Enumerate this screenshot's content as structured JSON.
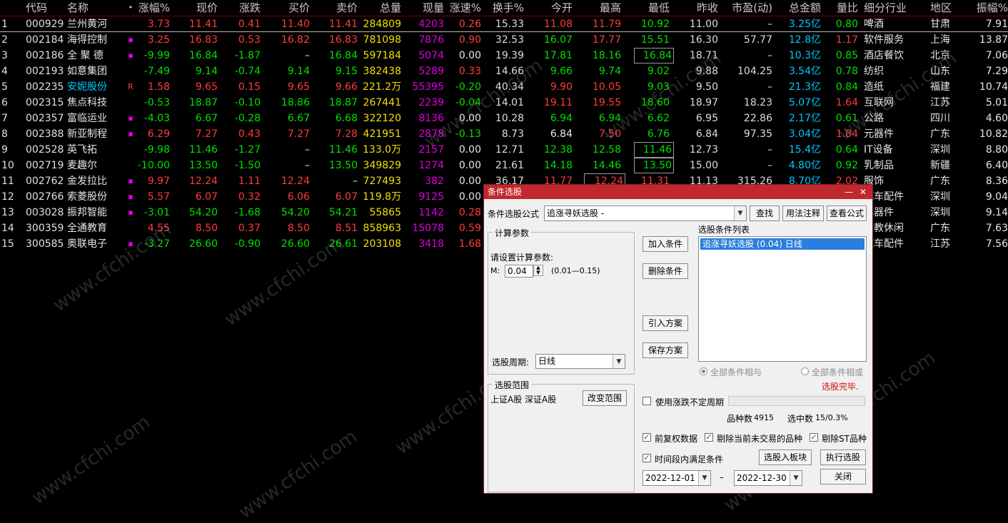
{
  "table": {
    "headers": {
      "idx": "",
      "code": "代码",
      "name": "名称",
      "flag": "•",
      "pct": "涨幅%",
      "price": "现价",
      "chg": "涨跌",
      "bid": "买价",
      "ask": "卖价",
      "vol": "总量",
      "cur": "现量",
      "spd": "涨速%",
      "turn": "换手%",
      "open": "今开",
      "high": "最高",
      "low": "最低",
      "prev": "昨收",
      "pe": "市盈(动)",
      "amt": "总金额",
      "vr": "量比",
      "ind": "细分行业",
      "reg": "地区",
      "amp": "振幅%"
    },
    "rows": [
      {
        "idx": "1",
        "code": "000929",
        "name": "兰州黄河",
        "flag": "",
        "pct": "3.73",
        "price": "11.41",
        "chg": "0.41",
        "bid": "11.40",
        "ask": "11.41",
        "vol": "284809",
        "cur": "4203",
        "spd": "0.26",
        "turn": "15.33",
        "open": "11.08",
        "high": "11.79",
        "low": "10.92",
        "prev": "11.00",
        "pe": "–",
        "amt": "3.25亿",
        "vr": "0.80",
        "ind": "啤酒",
        "reg": "甘肃",
        "amp": "7.91"
      },
      {
        "idx": "2",
        "code": "002184",
        "name": "海得控制",
        "flag": "▪",
        "pct": "3.25",
        "price": "16.83",
        "chg": "0.53",
        "bid": "16.82",
        "ask": "16.83",
        "vol": "781098",
        "cur": "7876",
        "spd": "0.90",
        "turn": "32.53",
        "open": "16.07",
        "high": "17.77",
        "low": "15.51",
        "prev": "16.30",
        "pe": "57.77",
        "amt": "12.8亿",
        "vr": "1.17",
        "ind": "软件服务",
        "reg": "上海",
        "amp": "13.87"
      },
      {
        "idx": "3",
        "code": "002186",
        "name": "全 聚 德",
        "flag": "▪",
        "pct": "-9.99",
        "price": "16.84",
        "chg": "-1.87",
        "bid": "–",
        "ask": "16.84",
        "vol": "597184",
        "cur": "5074",
        "spd": "0.00",
        "turn": "19.39",
        "open": "17.81",
        "high": "18.16",
        "low": "16.84",
        "prev": "18.71",
        "pe": "–",
        "amt": "10.3亿",
        "vr": "0.85",
        "ind": "酒店餐饮",
        "reg": "北京",
        "amp": "7.06"
      },
      {
        "idx": "4",
        "code": "002193",
        "name": "如意集团",
        "flag": "",
        "pct": "-7.49",
        "price": "9.14",
        "chg": "-0.74",
        "bid": "9.14",
        "ask": "9.15",
        "vol": "382438",
        "cur": "5289",
        "spd": "0.33",
        "turn": "14.66",
        "open": "9.66",
        "high": "9.74",
        "low": "9.02",
        "prev": "9.88",
        "pe": "104.25",
        "amt": "3.54亿",
        "vr": "0.78",
        "ind": "纺织",
        "reg": "山东",
        "amp": "7.29"
      },
      {
        "idx": "5",
        "code": "002235",
        "name": "安妮股份",
        "flag": "R",
        "pct": "1.58",
        "price": "9.65",
        "chg": "0.15",
        "bid": "9.65",
        "ask": "9.66",
        "vol": "221.2万",
        "cur": "55395",
        "spd": "-0.20",
        "turn": "40.34",
        "open": "9.90",
        "high": "10.05",
        "low": "9.03",
        "prev": "9.50",
        "pe": "–",
        "amt": "21.3亿",
        "vr": "0.84",
        "ind": "造纸",
        "reg": "福建",
        "amp": "10.74"
      },
      {
        "idx": "6",
        "code": "002315",
        "name": "焦点科技",
        "flag": "",
        "pct": "-0.53",
        "price": "18.87",
        "chg": "-0.10",
        "bid": "18.86",
        "ask": "18.87",
        "vol": "267441",
        "cur": "2239",
        "spd": "-0.04",
        "turn": "14.01",
        "open": "19.11",
        "high": "19.55",
        "low": "18.60",
        "prev": "18.97",
        "pe": "18.23",
        "amt": "5.07亿",
        "vr": "1.64",
        "ind": "互联网",
        "reg": "江苏",
        "amp": "5.01"
      },
      {
        "idx": "7",
        "code": "002357",
        "name": "富临运业",
        "flag": "▪",
        "pct": "-4.03",
        "price": "6.67",
        "chg": "-0.28",
        "bid": "6.67",
        "ask": "6.68",
        "vol": "322120",
        "cur": "8136",
        "spd": "0.00",
        "turn": "10.28",
        "open": "6.94",
        "high": "6.94",
        "low": "6.62",
        "prev": "6.95",
        "pe": "22.86",
        "amt": "2.17亿",
        "vr": "0.61",
        "ind": "公路",
        "reg": "四川",
        "amp": "4.60"
      },
      {
        "idx": "8",
        "code": "002388",
        "name": "新亚制程",
        "flag": "▪",
        "pct": "6.29",
        "price": "7.27",
        "chg": "0.43",
        "bid": "7.27",
        "ask": "7.28",
        "vol": "421951",
        "cur": "2878",
        "spd": "-0.13",
        "turn": "8.73",
        "open": "6.84",
        "high": "7.50",
        "low": "6.76",
        "prev": "6.84",
        "pe": "97.35",
        "amt": "3.04亿",
        "vr": "1.84",
        "ind": "元器件",
        "reg": "广东",
        "amp": "10.82"
      },
      {
        "idx": "9",
        "code": "002528",
        "name": "英飞拓",
        "flag": "",
        "pct": "-9.98",
        "price": "11.46",
        "chg": "-1.27",
        "bid": "–",
        "ask": "11.46",
        "vol": "133.0万",
        "cur": "2157",
        "spd": "0.00",
        "turn": "12.71",
        "open": "12.38",
        "high": "12.58",
        "low": "11.46",
        "prev": "12.73",
        "pe": "–",
        "amt": "15.4亿",
        "vr": "0.64",
        "ind": "IT设备",
        "reg": "深圳",
        "amp": "8.80"
      },
      {
        "idx": "10",
        "code": "002719",
        "name": "麦趣尔",
        "flag": "",
        "pct": "-10.00",
        "price": "13.50",
        "chg": "-1.50",
        "bid": "–",
        "ask": "13.50",
        "vol": "349829",
        "cur": "1274",
        "spd": "0.00",
        "turn": "21.61",
        "open": "14.18",
        "high": "14.46",
        "low": "13.50",
        "prev": "15.00",
        "pe": "–",
        "amt": "4.80亿",
        "vr": "0.92",
        "ind": "乳制品",
        "reg": "新疆",
        "amp": "6.40"
      },
      {
        "idx": "11",
        "code": "002762",
        "name": "金发拉比",
        "flag": "▪",
        "pct": "9.97",
        "price": "12.24",
        "chg": "1.11",
        "bid": "12.24",
        "ask": "–",
        "vol": "727493",
        "cur": "382",
        "spd": "0.00",
        "turn": "36.17",
        "open": "11.77",
        "high": "12.24",
        "low": "11.31",
        "prev": "11.13",
        "pe": "315.26",
        "amt": "8.70亿",
        "vr": "2.02",
        "ind": "服饰",
        "reg": "广东",
        "amp": "8.36"
      },
      {
        "idx": "12",
        "code": "002766",
        "name": "索菱股份",
        "flag": "▪",
        "pct": "5.57",
        "price": "6.07",
        "chg": "0.32",
        "bid": "6.06",
        "ask": "6.07",
        "vol": "119.8万",
        "cur": "9125",
        "spd": "0.00",
        "turn": "",
        "open": "",
        "high": "",
        "low": "",
        "prev": "",
        "pe": "",
        "amt": "",
        "vr": "",
        "ind": "汽车配件",
        "reg": "深圳",
        "amp": "9.04"
      },
      {
        "idx": "13",
        "code": "003028",
        "name": "振邦智能",
        "flag": "▪",
        "pct": "-3.01",
        "price": "54.20",
        "chg": "-1.68",
        "bid": "54.20",
        "ask": "54.21",
        "vol": "55865",
        "cur": "1142",
        "spd": "0.28",
        "turn": "",
        "open": "",
        "high": "",
        "low": "",
        "prev": "",
        "pe": "",
        "amt": "",
        "vr": "",
        "ind": "元器件",
        "reg": "深圳",
        "amp": "9.14"
      },
      {
        "idx": "14",
        "code": "300359",
        "name": "全通教育",
        "flag": "",
        "pct": "4.55",
        "price": "8.50",
        "chg": "0.37",
        "bid": "8.50",
        "ask": "8.51",
        "vol": "858963",
        "cur": "15078",
        "spd": "0.59",
        "turn": "",
        "open": "",
        "high": "",
        "low": "",
        "prev": "",
        "pe": "",
        "amt": "",
        "vr": "",
        "ind": "文教休闲",
        "reg": "广东",
        "amp": "7.63"
      },
      {
        "idx": "15",
        "code": "300585",
        "name": "奥联电子",
        "flag": "▪",
        "pct": "-3.27",
        "price": "26.60",
        "chg": "-0.90",
        "bid": "26.60",
        "ask": "26.61",
        "vol": "203108",
        "cur": "3418",
        "spd": "1.68",
        "turn": "",
        "open": "",
        "high": "",
        "low": "",
        "prev": "",
        "pe": "",
        "amt": "",
        "vr": "",
        "ind": "汽车配件",
        "reg": "江苏",
        "amp": "7.56"
      }
    ]
  },
  "watermark": "www.cfchi.com",
  "dialog": {
    "title": "条件选股",
    "min_icon": "—",
    "close_icon": "✕",
    "formula_label": "条件选股公式",
    "formula_value": "追涨寻妖选股 -",
    "dropdown_icon": "▼",
    "find_btn": "查找",
    "usage_btn": "用法注释",
    "view_formula_btn": "查看公式",
    "calc_group": "计算参数",
    "calc_prompt": "请设置计算参数:",
    "param_label": "M:",
    "param_value": "0.04",
    "param_range": "(0.01—0.15)",
    "add_cond_btn": "加入条件",
    "del_cond_btn": "删除条件",
    "import_btn": "引入方案",
    "save_btn": "保存方案",
    "cond_list_label": "选股条件列表",
    "cond_items": [
      "追涨寻妖选股 (0.04) 日线"
    ],
    "period_label": "选股周期:",
    "period_value": "日线",
    "radio_and": "全部条件相与",
    "radio_or": "全部条件相或",
    "status": "选股完毕.",
    "scope_group": "选股范围",
    "scope_value": "上证A股 深证A股",
    "change_scope_btn": "改变范围",
    "use_pct_label": "使用涨跌不定周期",
    "count_label": "品种数",
    "count_value": "4915",
    "hit_label": "选中数",
    "hit_value": "15/0.3%",
    "chk_fq": "前复权数据",
    "chk_notrade": "剔除当前未交易的品种",
    "chk_st": "剔除ST品种",
    "chk_range": "时间段内满足条件",
    "to_block_btn": "选股入板块",
    "exec_btn": "执行选股",
    "date_from": "2022-12-01",
    "date_sep": "–",
    "date_to": "2022-12-30",
    "close_btn": "关闭",
    "colors": {
      "title_bar": "#c0282e",
      "selection": "#2a7ee0",
      "status": "#d01010"
    }
  }
}
